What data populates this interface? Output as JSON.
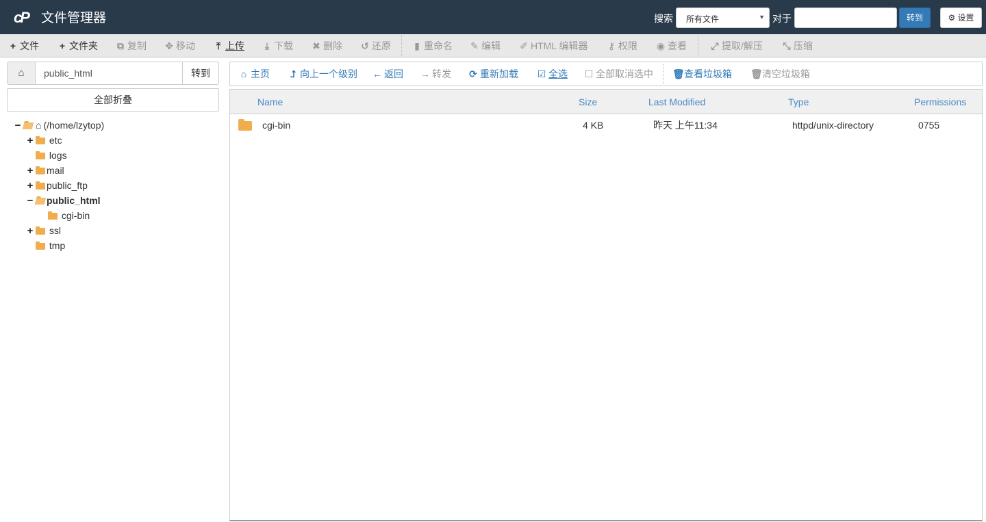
{
  "header": {
    "logo": "cP",
    "title": "文件管理器",
    "search_label": "搜索",
    "search_scope": "所有文件",
    "for_label": "对于",
    "search_value": "",
    "go_label": "转到",
    "settings_label": "设置"
  },
  "toolbar": {
    "items": [
      {
        "icon": "plus-icon",
        "glyph": "+",
        "label": "文件",
        "enabled": true
      },
      {
        "icon": "plus-icon",
        "glyph": "+",
        "label": "文件夹",
        "enabled": true
      },
      {
        "icon": "copy-icon",
        "glyph": "⧉",
        "label": "复制",
        "enabled": false
      },
      {
        "icon": "move-icon",
        "glyph": "✥",
        "label": "移动",
        "enabled": false
      },
      {
        "icon": "upload-icon",
        "glyph": "⤒",
        "label": "上传",
        "enabled": true
      },
      {
        "icon": "download-icon",
        "glyph": "⤓",
        "label": "下载",
        "enabled": false
      },
      {
        "icon": "delete-icon",
        "glyph": "✖",
        "label": "删除",
        "enabled": false
      },
      {
        "icon": "restore-icon",
        "glyph": "↺",
        "label": "还原",
        "enabled": false
      },
      {
        "icon": "file-icon",
        "glyph": "▮",
        "label": "重命名",
        "enabled": false
      },
      {
        "icon": "pencil-icon",
        "glyph": "✎",
        "label": "编辑",
        "enabled": false
      },
      {
        "icon": "edit-square-icon",
        "glyph": "✐",
        "label": "HTML 编辑器",
        "enabled": false
      },
      {
        "icon": "key-icon",
        "glyph": "⚷",
        "label": "权限",
        "enabled": false
      },
      {
        "icon": "eye-icon",
        "glyph": "◉",
        "label": "查看",
        "enabled": false
      },
      {
        "icon": "expand-icon",
        "glyph": "⤢",
        "label": "提取/解压",
        "enabled": false
      },
      {
        "icon": "compress-icon",
        "glyph": "⤡",
        "label": "压缩",
        "enabled": false
      }
    ]
  },
  "sidebar": {
    "path_value": "public_html",
    "go_label": "转到",
    "collapse_label": "全部折叠",
    "tree": [
      {
        "label": "(/home/lzytop)",
        "toggle": "−",
        "open": true,
        "home": true
      },
      {
        "label": "etc",
        "toggle": "+"
      },
      {
        "label": "logs",
        "toggle": ""
      },
      {
        "label": "mail",
        "toggle": "+"
      },
      {
        "label": "public_ftp",
        "toggle": "+"
      },
      {
        "label": "public_html",
        "toggle": "−",
        "open": true,
        "selected": true
      },
      {
        "label": "cgi-bin",
        "toggle": ""
      },
      {
        "label": "ssl",
        "toggle": "+"
      },
      {
        "label": "tmp",
        "toggle": ""
      }
    ]
  },
  "nav": {
    "items": [
      {
        "icon": "home-icon",
        "glyph": "⌂",
        "label": "主页",
        "enabled": true
      },
      {
        "icon": "level-up-icon",
        "glyph": "⮥",
        "label": "向上一个级别",
        "enabled": true
      },
      {
        "icon": "arrow-left-icon",
        "glyph": "←",
        "label": "返回",
        "enabled": true
      },
      {
        "icon": "arrow-right-icon",
        "glyph": "→",
        "label": "转发",
        "enabled": false
      },
      {
        "icon": "refresh-icon",
        "glyph": "⟳",
        "label": "重新加载",
        "enabled": true
      },
      {
        "icon": "checkbox-checked-icon",
        "glyph": "☑",
        "label": "全选",
        "enabled": true
      },
      {
        "icon": "checkbox-empty-icon",
        "glyph": "☐",
        "label": "全部取消选中",
        "enabled": false
      },
      {
        "icon": "trash-icon",
        "glyph": "🗑",
        "label": "查看垃圾箱",
        "enabled": true
      },
      {
        "icon": "trash-icon",
        "glyph": "🗑",
        "label": "清空垃圾箱",
        "enabled": false
      }
    ]
  },
  "files": {
    "columns": [
      "Name",
      "Size",
      "Last Modified",
      "Type",
      "Permissions"
    ],
    "rows": [
      {
        "name": "cgi-bin",
        "size": "4 KB",
        "modified": "昨天 上午11:34",
        "type": "httpd/unix-directory",
        "permissions": "0755"
      }
    ]
  },
  "colors": {
    "header_bg": "#293a4a",
    "accent": "#337ab7",
    "folder": "#f0ad4e",
    "column_header_text": "#4a89c8"
  }
}
